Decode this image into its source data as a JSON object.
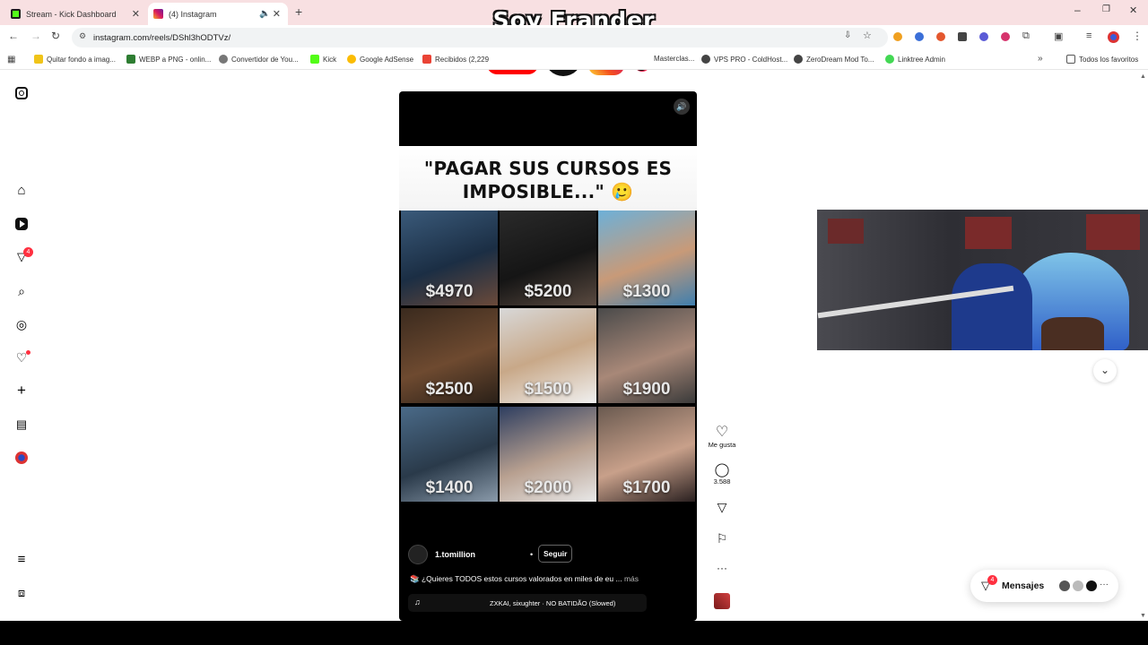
{
  "browser": {
    "tabs": [
      {
        "title": "Stream - Kick Dashboard",
        "active": false
      },
      {
        "title": "(4) Instagram",
        "active": true
      }
    ],
    "url": "instagram.com/reels/DShl3hODTVz/",
    "bookmarks": [
      "Quitar fondo a imag...",
      "WEBP a PNG - onlin...",
      "Convertidor de You...",
      "Kick",
      "Google AdSense",
      "Recibidos (2,229",
      "Masterclas...",
      "VPS PRO - ColdHost...",
      "ZeroDream Mod To...",
      "Linktree Admin"
    ],
    "all_bookmarks": "Todos los favoritos"
  },
  "overlay": {
    "brand": "Soy Frander"
  },
  "sidebar": {
    "notification_badge": "4"
  },
  "reel": {
    "title_line1": "\"PAGAR SUS CURSOS ES",
    "title_line2": "IMPOSIBLE...\" 🥲",
    "prices": [
      "$4970",
      "$5200",
      "$1300",
      "$2500",
      "$1500",
      "$1900",
      "$1400",
      "$2000",
      "$1700"
    ],
    "username": "1.tomillion",
    "follow_label": "Seguir",
    "caption": "¿Quieres TODOS estos cursos valorados en miles de eu ...",
    "more_label": "más",
    "audio": "ZXKAI, sixughter · NO BATIDÃO (Slowed)"
  },
  "actions": {
    "like_label": "Me gusta",
    "comments_count": "3.588"
  },
  "messages": {
    "label": "Mensajes",
    "badge": "4"
  }
}
